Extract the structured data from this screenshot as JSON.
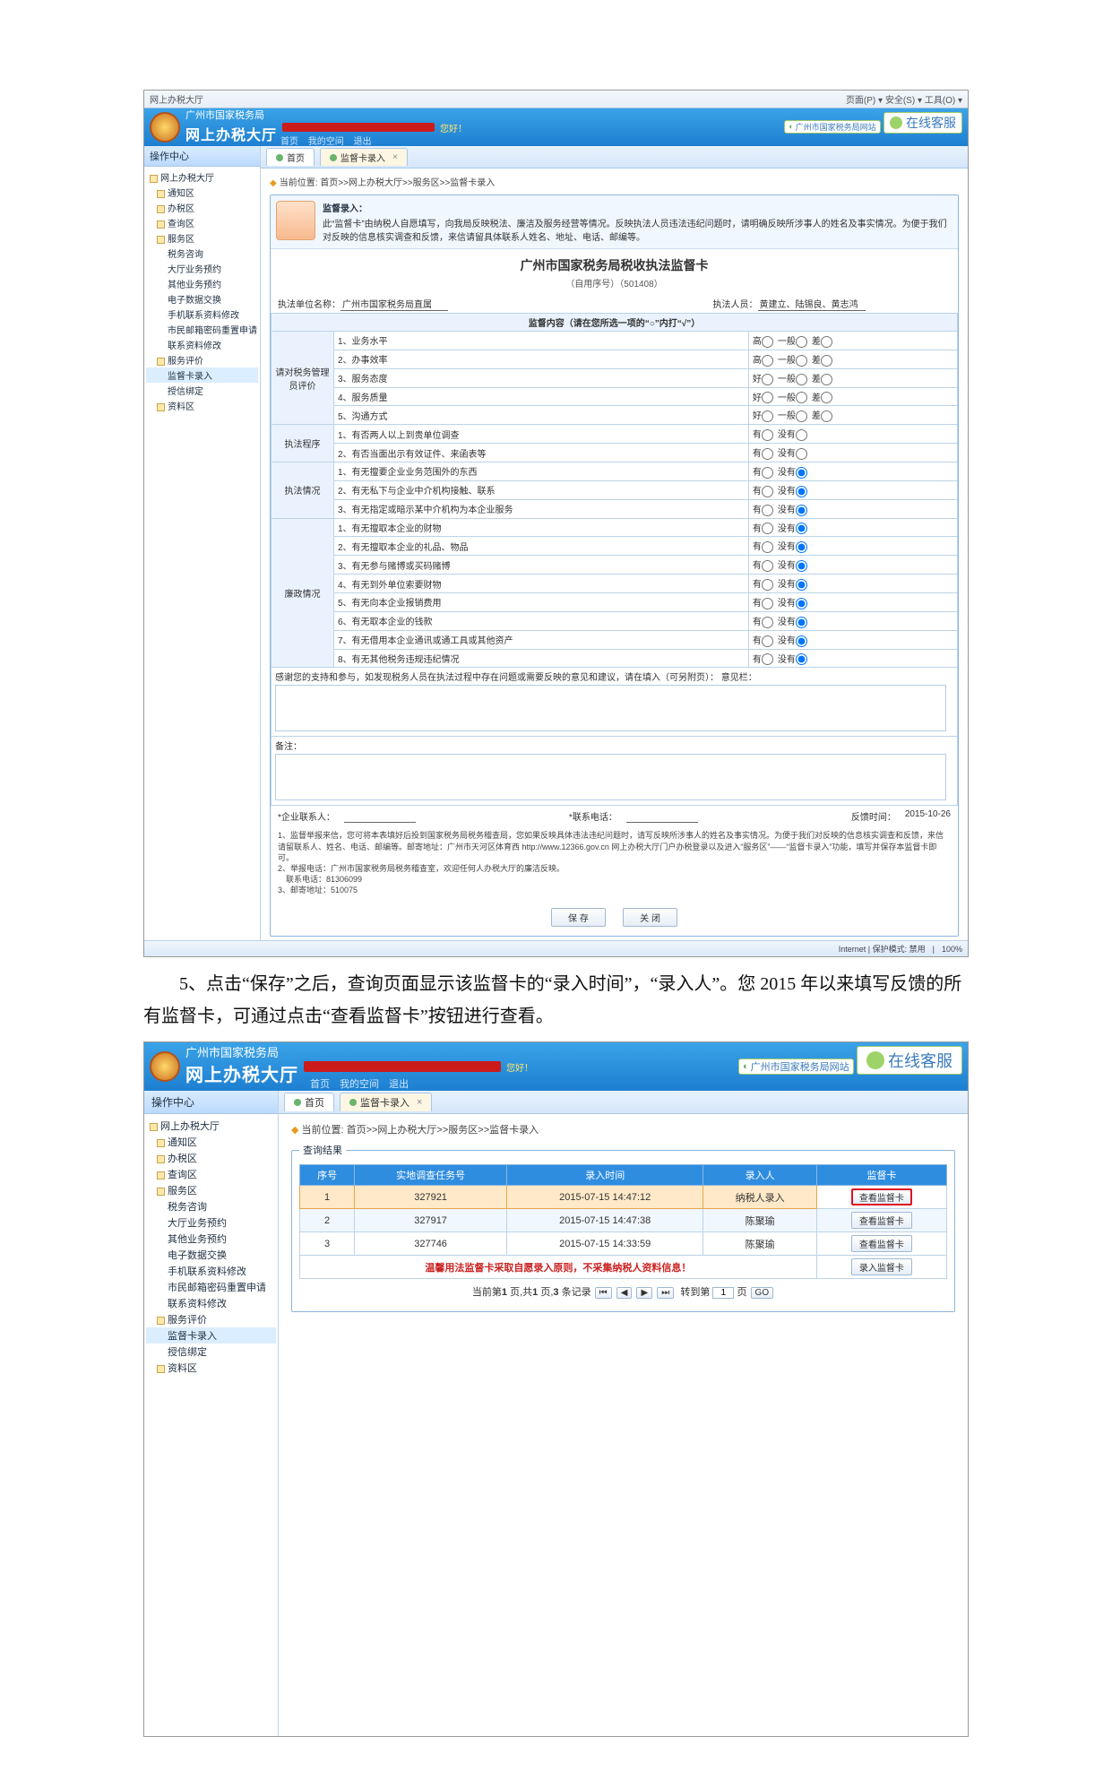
{
  "doc": {
    "instruction": "　　5、点击“保存”之后，查询页面显示该监督卡的“录入时间”，“录入人”。您 2015 年以来填写反馈的所有监督卡，可通过点击“查看监督卡”按钮进行查看。"
  },
  "s1": {
    "browser": {
      "title": "网上办税大厅",
      "rightTools": "页面(P) ▾ 安全(S) ▾ 工具(O) ▾"
    },
    "header": {
      "org": "广州市国家税务局",
      "app": "网上办税大厅",
      "hello": "您好！",
      "nav1": "首页",
      "nav2": "我的空间",
      "nav3": "退出",
      "kfLink": "广州市国家税务局网站",
      "kfChat": "在线客服"
    },
    "opTitle": "操作中心",
    "tree": {
      "root": "网上办税大厅",
      "c_notice": "通知区",
      "c_ban": "办税区",
      "c_query": "查询区",
      "c_serv": "服务区",
      "s_tax": "税务咨询",
      "s_hall": "大厅业务预约",
      "s_other": "其他业务预约",
      "s_edata": "电子数据交换",
      "s_sm": "手机联系资料修改",
      "s_mima": "市民邮箱密码重置申请",
      "s_lx": "联系资料修改",
      "c_eval": "服务评价",
      "s_card": "监督卡录入",
      "s_shouxin": "授信绑定",
      "c_res": "资料区"
    },
    "tabs": {
      "home": "首页",
      "card": "监督卡录入"
    },
    "crumb": "当前位置: 首页>>网上办税大厅>>服务区>>监督卡录入",
    "intro": {
      "title": "监督录入：",
      "text": "此“监督卡”由纳税人自愿填写，向我局反映税法、廉洁及服务经营等情况。反映执法人员违法违纪问题时，请明确反映所涉事人的姓名及事实情况。为便于我们对反映的信息核实调查和反馈，来信请留具体联系人姓名、地址、电话、邮编等。"
    },
    "form": {
      "title": "广州市国家税务局税收执法监督卡",
      "sub": "（自用序号）（501408）",
      "unitLabel": "执法单位名称：",
      "unitVal": "广州市国家税务局直属",
      "personLabel": "执法人员：",
      "personVal": "黄建立、陆锡良、黄志鸿",
      "midHead": "监督内容（请在您所选一项的“○”内打“√”）",
      "sec1": "请对税务管理员评价",
      "sec2": "执法程序",
      "sec3": "执法情况",
      "sec4": "廉政情况",
      "r1": "1、业务水平",
      "r2": "2、办事效率",
      "r3": "3、服务态度",
      "r4": "4、服务质量",
      "r5": "5、沟通方式",
      "r6": "1、有否两人以上到贵单位调查",
      "r7": "2、有否当面出示有效证件、来函表等",
      "r8": "1、有无擅要企业业务范围外的东西",
      "r9": "2、有无私下与企业中介机构接触、联系",
      "r10": "3、有无指定或暗示某中介机构为本企业服务",
      "r11": "1、有无擅取本企业的财物",
      "r12": "2、有无擅取本企业的礼品、物品",
      "r13": "3、有无参与赌博或买码赌博",
      "r14": "4、有无到外单位索要财物",
      "r15": "5、有无向本企业报销费用",
      "r16": "6、有无取本企业的钱款",
      "r17": "7、有无借用本企业通讯或通工具或其他资产",
      "r18": "8、有无其他税务违规违纪情况",
      "opts5": {
        "o1": "高",
        "o2": "一般",
        "o3": "差"
      },
      "opts5b": {
        "o1": "好",
        "o2": "一般",
        "o3": "差"
      },
      "opts2": {
        "o1": "有",
        "o2": "没有"
      },
      "taLabel": "感谢您的支持和参与，如发现税务人员在执法过程中存在问题或需要反映的意见和建议，请在填入（可另附页）：\n意见栏：",
      "remarkLabel": "备注：",
      "contactLabel": "*企业联系人：",
      "phoneLabel": "*联系电话：",
      "dateLabel": "反馈时间：",
      "dateVal": "2015-10-26",
      "note": "1、监督举报来信，您可将本表填好后投到国家税务局税务稽查局，您如果反映具体违法违纪问题时，请写反映所涉事人的姓名及事实情况。为便于我们对反映的信息核实调查和反馈，来信请留联系人、姓名、电话、邮编等。邮寄地址：广州市天河区体育西 http://www.12366.gov.cn 网上办税大厅门户办税登录以及进入“服务区”——“监督卡录入”功能，填写并保存本监督卡即可。\n2、举报电话：广州市国家税务局税务稽查室，欢迎任何人办税大厅的廉洁反映。\n　联系电话：81306099\n3、邮寄地址：510075",
      "btnSave": "保  存",
      "btnClose": "关  闭"
    },
    "status": {
      "net": "Internet | 保护模式: 禁用",
      "zoom": "100%"
    }
  },
  "s2": {
    "header": {
      "org": "广州市国家税务局",
      "app": "网上办税大厅",
      "hello": "您好！",
      "nav1": "首页",
      "nav2": "我的空间",
      "nav3": "退出",
      "kfLink": "广州市国家税务局网站",
      "kfChat": "在线客服"
    },
    "opTitle": "操作中心",
    "tree": {
      "root": "网上办税大厅",
      "c_notice": "通知区",
      "c_ban": "办税区",
      "c_query": "查询区",
      "c_serv": "服务区",
      "s_tax": "税务咨询",
      "s_hall": "大厅业务预约",
      "s_other": "其他业务预约",
      "s_edata": "电子数据交换",
      "s_sm": "手机联系资料修改",
      "s_mima": "市民邮箱密码重置申请",
      "s_lx": "联系资料修改",
      "c_eval": "服务评价",
      "s_card": "监督卡录入",
      "s_shouxin": "授信绑定",
      "c_res": "资料区"
    },
    "tabs": {
      "home": "首页",
      "card": "监督卡录入"
    },
    "crumb": "当前位置: 首页>>网上办税大厅>>服务区>>监督卡录入",
    "panelTitle": "查询结果",
    "table": {
      "h1": "序号",
      "h2": "实地调查任务号",
      "h3": "录入时间",
      "h4": "录入人",
      "h5": "监督卡",
      "rows": [
        {
          "n": "1",
          "task": "327921",
          "time": "2015-07-15 14:47:12",
          "user": "纳税人录入",
          "btn": "查看监督卡",
          "hl": true
        },
        {
          "n": "2",
          "task": "327917",
          "time": "2015-07-15 14:47:38",
          "user": "陈聚瑜",
          "btn": "查看监督卡",
          "hl": false
        },
        {
          "n": "3",
          "task": "327746",
          "time": "2015-07-15 14:33:59",
          "user": "陈聚瑜",
          "btn": "查看监督卡",
          "hl": false
        }
      ],
      "entryBtn": "录入监督卡",
      "warn": "温馨用法监督卡采取自愿录入原则，不采集纳税人资料信息！",
      "pager": {
        "text1": "当前第",
        "page": "1",
        "text2": "页,共",
        "tp": "1",
        "text3": "页,",
        "cnt": "3",
        "text4": "条记录",
        "toLabel": "转到第",
        "pageInput": "1",
        "pageUnit": "页",
        "go": "GO"
      }
    }
  }
}
